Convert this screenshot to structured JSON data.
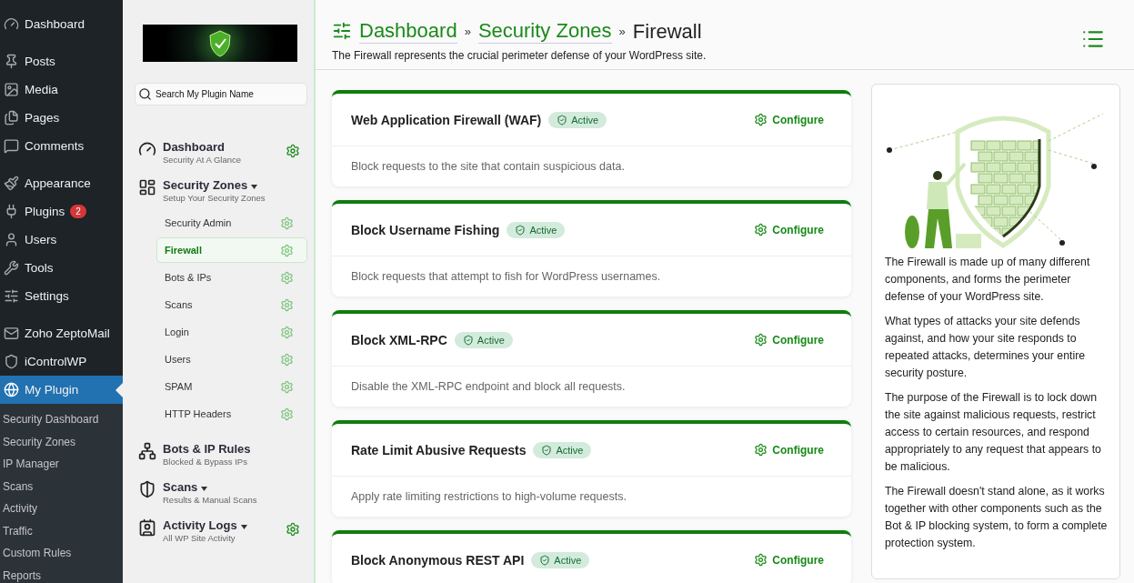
{
  "wp_menu_groups": [
    {
      "items": [
        {
          "label": "Dashboard",
          "kind": "gauge",
          "selected": false
        }
      ]
    },
    {
      "items": [
        {
          "label": "Posts",
          "kind": "pin",
          "selected": false
        },
        {
          "label": "Media",
          "kind": "media",
          "selected": false
        },
        {
          "label": "Pages",
          "kind": "pages",
          "selected": false
        },
        {
          "label": "Comments",
          "kind": "comment",
          "selected": false
        }
      ]
    },
    {
      "items": [
        {
          "label": "Appearance",
          "kind": "brush",
          "selected": false
        },
        {
          "label": "Plugins",
          "kind": "plug",
          "selected": false,
          "badge": "2"
        },
        {
          "label": "Users",
          "kind": "user",
          "selected": false
        },
        {
          "label": "Tools",
          "kind": "wrench",
          "selected": false
        },
        {
          "label": "Settings",
          "kind": "sliders",
          "selected": false
        }
      ]
    },
    {
      "items": [
        {
          "label": "Zoho ZeptoMail",
          "kind": "mail",
          "selected": false
        },
        {
          "label": "iControlWP",
          "kind": "shield",
          "selected": false
        },
        {
          "label": "My Plugin",
          "kind": "globe",
          "selected": true
        }
      ]
    }
  ],
  "wp_submenu": [
    "Security Dashboard",
    "Security Zones",
    "IP Manager",
    "Scans",
    "Activity",
    "Traffic",
    "Custom Rules",
    "Reports"
  ],
  "plugin_nav": {
    "search": {
      "placeholder": "Search My Plugin Name"
    },
    "sections": [
      {
        "title": "Dashboard",
        "subtitle": "Security At A Glance",
        "kind": "gauge",
        "dropdown": false,
        "gear": true
      },
      {
        "title": "Security Zones",
        "subtitle": "Setup Your Security Zones",
        "kind": "layout",
        "dropdown": true,
        "gear": false,
        "children": [
          {
            "label": "Security Admin",
            "selected": false
          },
          {
            "label": "Firewall",
            "selected": true
          },
          {
            "label": "Bots & IPs",
            "selected": false
          },
          {
            "label": "Scans",
            "selected": false
          },
          {
            "label": "Login",
            "selected": false
          },
          {
            "label": "Users",
            "selected": false
          },
          {
            "label": "SPAM",
            "selected": false
          },
          {
            "label": "HTTP Headers",
            "selected": false
          }
        ]
      },
      {
        "title": "Bots & IP Rules",
        "subtitle": "Blocked & Bypass IPs",
        "kind": "network",
        "dropdown": false,
        "gear": false
      },
      {
        "title": "Scans",
        "subtitle": "Results & Manual Scans",
        "kind": "shield",
        "dropdown": true,
        "gear": false
      },
      {
        "title": "Activity Logs",
        "subtitle": "All WP Site Activity",
        "kind": "contact",
        "dropdown": true,
        "gear": true
      }
    ]
  },
  "header": {
    "breadcrumb": [
      {
        "label": "Dashboard",
        "link": true
      },
      {
        "label": "Security Zones",
        "link": true
      },
      {
        "label": "Firewall",
        "link": false
      }
    ],
    "separator": "»",
    "description": "The Firewall represents the crucial perimeter defense of your WordPress site."
  },
  "cards": [
    {
      "title": "Web Application Firewall (WAF)",
      "status": "Active",
      "action": "Configure",
      "description": "Block requests to the site that contain suspicious data."
    },
    {
      "title": "Block Username Fishing",
      "status": "Active",
      "action": "Configure",
      "description": "Block requests that attempt to fish for WordPress usernames."
    },
    {
      "title": "Block XML-RPC",
      "status": "Active",
      "action": "Configure",
      "description": "Disable the XML-RPC endpoint and block all requests."
    },
    {
      "title": "Rate Limit Abusive Requests",
      "status": "Active",
      "action": "Configure",
      "description": "Apply rate limiting restrictions to high-volume requests."
    },
    {
      "title": "Block Anonymous REST API",
      "status": "Active",
      "action": "Configure"
    }
  ],
  "info_panel": {
    "paragraphs": [
      "The Firewall is made up of many different components, and forms the perimeter defense of your WordPress site.",
      "What types of attacks your site defends against, and how your site responds to repeated attacks, determines your entire security posture.",
      "The purpose of the Firewall is to lock down the site against malicious requests, restrict access to certain resources, and respond appropriately to any request that appears to be malicious.",
      "The Firewall doesn't stand alone, as it works together with other components such as the Bot & IP blocking system, to form a complete protection system."
    ]
  }
}
